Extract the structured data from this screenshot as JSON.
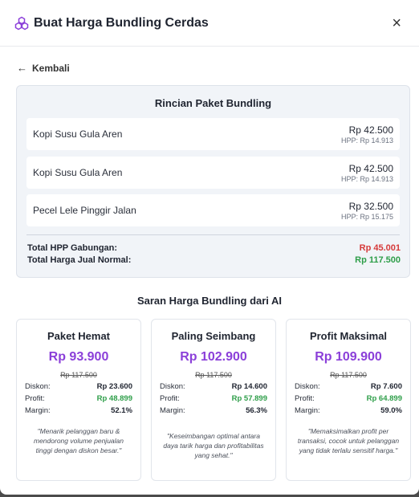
{
  "header": {
    "title": "Buat Harga Bundling Cerdas",
    "close_icon": "×"
  },
  "back": {
    "arrow": "←",
    "label": "Kembali"
  },
  "summary": {
    "title": "Rincian Paket Bundling",
    "items": [
      {
        "name": "Kopi Susu Gula Aren",
        "price": "Rp 42.500",
        "hpp": "HPP: Rp 14.913"
      },
      {
        "name": "Kopi Susu Gula Aren",
        "price": "Rp 42.500",
        "hpp": "HPP: Rp 14.913"
      },
      {
        "name": "Pecel Lele Pinggir Jalan",
        "price": "Rp 32.500",
        "hpp": "HPP: Rp 15.175"
      }
    ],
    "total_hpp_label": "Total HPP Gabungan:",
    "total_hpp_value": "Rp 45.001",
    "total_normal_label": "Total Harga Jual Normal:",
    "total_normal_value": "Rp 117.500"
  },
  "suggestions": {
    "title": "Saran Harga Bundling dari AI",
    "cards": [
      {
        "name": "Paket Hemat",
        "price": "Rp 93.900",
        "original": "Rp 117.500",
        "discount_label": "Diskon:",
        "discount": "Rp 23.600",
        "profit_label": "Profit:",
        "profit": "Rp 48.899",
        "margin_label": "Margin:",
        "margin": "52.1%",
        "description": "\"Menarik pelanggan baru & mendorong volume penjualan tinggi dengan diskon besar.\""
      },
      {
        "name": "Paling Seimbang",
        "price": "Rp 102.900",
        "original": "Rp 117.500",
        "discount_label": "Diskon:",
        "discount": "Rp 14.600",
        "profit_label": "Profit:",
        "profit": "Rp 57.899",
        "margin_label": "Margin:",
        "margin": "56.3%",
        "description": "\"Keseimbangan optimal antara daya tarik harga dan profitabilitas yang sehat.\""
      },
      {
        "name": "Profit Maksimal",
        "price": "Rp 109.900",
        "original": "Rp 117.500",
        "discount_label": "Diskon:",
        "discount": "Rp 7.600",
        "profit_label": "Profit:",
        "profit": "Rp 64.899",
        "margin_label": "Margin:",
        "margin": "59.0%",
        "description": "\"Memaksimalkan profit per transaksi, cocok untuk pelanggan yang tidak terlalu sensitif harga.\""
      }
    ]
  },
  "colors": {
    "accent": "#8b3fd9",
    "hpp_total": "#d63a3a",
    "profit": "#2e9e49"
  }
}
